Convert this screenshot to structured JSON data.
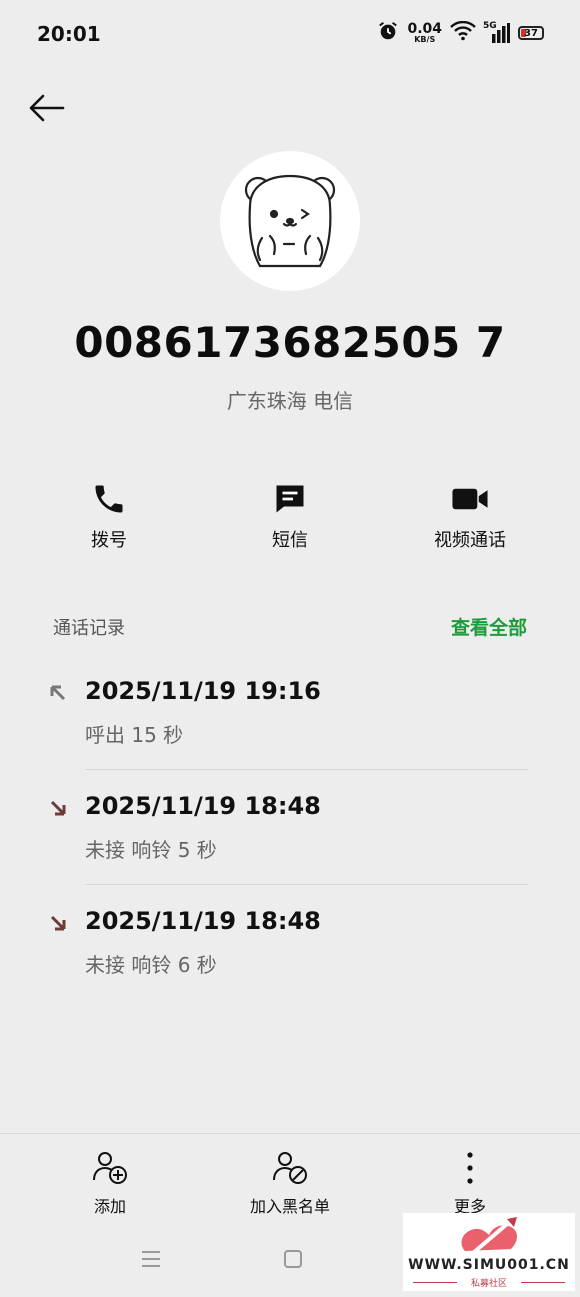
{
  "status_bar": {
    "time": "20:01",
    "speed_value": "0.04",
    "speed_unit": "KB/S",
    "network": "5G",
    "battery": "37"
  },
  "contact": {
    "phone": "0086173682505 7",
    "location": "广东珠海 电信"
  },
  "actions": [
    {
      "label": "拨号"
    },
    {
      "label": "短信"
    },
    {
      "label": "视频通话"
    }
  ],
  "call_log": {
    "title": "通话记录",
    "view_all": "查看全部",
    "records": [
      {
        "datetime": "2025/11/19 19:16",
        "detail": "呼出  15 秒",
        "direction": "outgoing"
      },
      {
        "datetime": "2025/11/19 18:48",
        "detail": "未接  响铃 5 秒",
        "direction": "missed"
      },
      {
        "datetime": "2025/11/19 18:48",
        "detail": "未接  响铃 6 秒",
        "direction": "missed"
      }
    ]
  },
  "bottom_bar": [
    {
      "label": "添加"
    },
    {
      "label": "加入黑名单"
    },
    {
      "label": "更多"
    }
  ],
  "watermark": {
    "text": "WWW.SIMU001.CN",
    "subtext": "私募社区"
  },
  "colors": {
    "accent_green": "#1e9b3a",
    "missed_arrow": "#6b3a3a",
    "background": "#ededed"
  }
}
